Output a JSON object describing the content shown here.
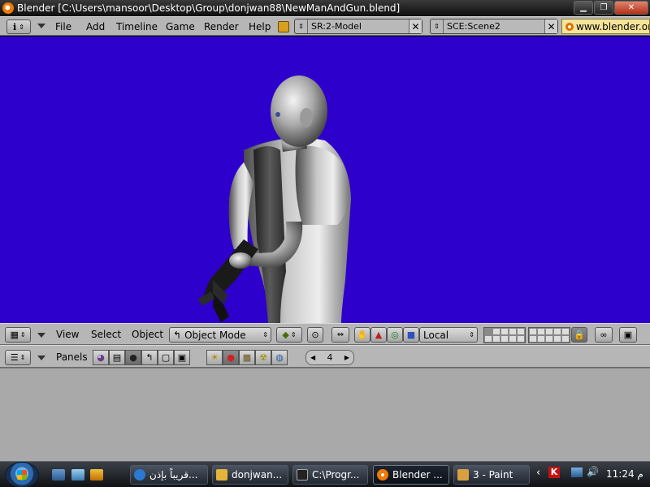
{
  "window": {
    "title": "Blender [C:\\Users\\mansoor\\Desktop\\Group\\donjwan88\\NewManAndGun.blend]"
  },
  "menubar": {
    "menus": [
      "File",
      "Add",
      "Timeline",
      "Game",
      "Render",
      "Help"
    ],
    "screen_field": "SR:2-Model",
    "scene_field": "SCE:Scene2",
    "url": "www.blender.org"
  },
  "view3d_header": {
    "menus": [
      "View",
      "Select",
      "Object"
    ],
    "mode": "Object Mode",
    "orientation": "Local"
  },
  "buttons_header": {
    "panels_label": "Panels",
    "frame_value": "4"
  },
  "taskbar": {
    "tasks": [
      {
        "label": "قريباً بإذن...",
        "icon": "ie-icon",
        "color": "#2a7ad0"
      },
      {
        "label": "donjwan...",
        "icon": "folder-icon",
        "color": "#e2b53a"
      },
      {
        "label": "C:\\Progr...",
        "icon": "console-icon",
        "color": "#222222"
      },
      {
        "label": "Blender ...",
        "icon": "blender-icon",
        "color": "#f07a00"
      },
      {
        "label": "3 - Paint",
        "icon": "paint-icon",
        "color": "#d8a040"
      }
    ],
    "clock": "11:24 م"
  },
  "colors": {
    "viewport_bg": "#2d00cc",
    "panel_bg": "#b6b6b6"
  }
}
